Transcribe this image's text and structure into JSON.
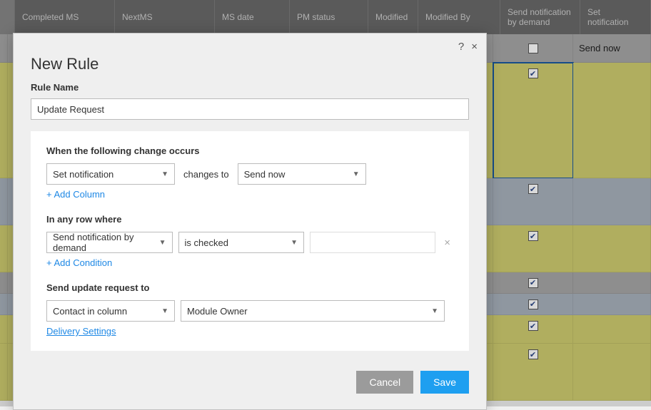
{
  "columns": {
    "completed_ms": "Completed MS",
    "next_ms": "NextMS",
    "ms_date": "MS date",
    "pm_status": "PM status",
    "modified": "Modified",
    "modified_by": "Modified By",
    "send_notification_by_demand": "Send notification by demand",
    "set_notification": "Set notification"
  },
  "rows": {
    "r0_set": "Send now"
  },
  "dialog": {
    "title": "New Rule",
    "help": "?",
    "close": "×",
    "rule_name_label": "Rule Name",
    "rule_name_value": "Update Request",
    "section_change": "When the following change occurs",
    "change_column": "Set notification",
    "change_verb": "changes to",
    "change_value": "Send now",
    "add_column": "Add Column",
    "section_cond": "In any row where",
    "cond_column": "Send notification by demand",
    "cond_operator": "is checked",
    "add_condition": "Add Condition",
    "section_recipient": "Send update request to",
    "recipient_mode": "Contact in column",
    "recipient_value": "Module Owner",
    "delivery_settings": "Delivery Settings",
    "cancel": "Cancel",
    "save": "Save"
  }
}
